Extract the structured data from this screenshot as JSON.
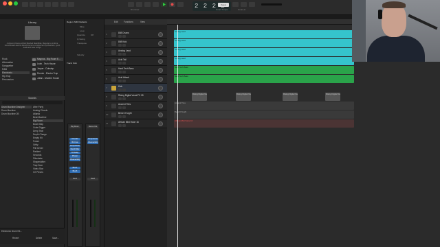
{
  "toolbar": {
    "lcd": "2 2 2 2",
    "labels": [
      "Drummer",
      "Smart Tempo",
      "Tuner",
      "Count-in"
    ],
    "tempo_badge": "Keep"
  },
  "library": {
    "title": "Library",
    "description": "A dynamic Dance-Hybrid Mashed Beat/Mike, Maguire & combine Grooveboard  electric-sound drums to complement synthesizers, synth leads and bass strings.",
    "categories": [
      "Rock",
      "Alternative",
      "Songwriter",
      "R&B",
      "Electronic",
      "Hip Hop",
      "Percussion"
    ],
    "drummers": [
      {
        "name": "Magnus - Big Room E..."
      },
      {
        "name": "Leah - Tech House"
      },
      {
        "name": "Jasper - Dubstep"
      },
      {
        "name": "Ronnie - Electro Trap"
      },
      {
        "name": "Julian - Modern House"
      }
    ],
    "sounds_title": "Sounds",
    "sound_cats": [
      "Drum Machine Designer",
      "Drum Machine",
      "Drum Machine 2B"
    ],
    "sound_items": [
      "After Party",
      "Analog Chords",
      "Atlanta",
      "Beat Machine",
      "Big Room",
      "Boom Bap",
      "Crate Digger",
      "Deep Tech",
      "Depth Charge",
      "Empty Kit",
      "Future",
      "Gritty",
      "Pile Driver",
      "Radiant",
      "Seconds",
      "Silverlake",
      "Shapeshifter",
      "Trap Door",
      "Video Star",
      "XX Pieces"
    ],
    "footer_label": "Electronic Drum Kit...",
    "revert": "Revert",
    "delete": "Delete",
    "save": "Save..."
  },
  "inspector": {
    "region_title": "Region: MIDI Defaults",
    "fields": [
      "Mute",
      "Loop",
      "Quantize",
      "Q-Swing",
      "Transpose",
      "Velocity"
    ],
    "field_values": [
      "",
      "",
      "Off",
      "",
      "",
      ""
    ],
    "track_label": "Track: Kick",
    "channel_name": "Big Room",
    "ch2": "Stereo Out",
    "plugins": [
      "Drumkit",
      "Bit Crus",
      "Compressor",
      "Rand Filter",
      "Dr Delay",
      "Phaser",
      "Channel EQ"
    ],
    "bus_labels": [
      "Bus 4",
      "Bus 6"
    ],
    "bottom_labels": [
      "M",
      "S",
      "Bnce"
    ],
    "read": "Read"
  },
  "tracks": [
    {
      "num": "1",
      "name": "808 Drums"
    },
    {
      "num": "2",
      "name": "808 Kick"
    },
    {
      "num": "3",
      "name": "Analog Lead"
    },
    {
      "num": "4",
      "name": "Acid Tail"
    },
    {
      "num": "5",
      "name": "Hard Tech Bass"
    },
    {
      "num": "6",
      "name": "Acid Attack"
    },
    {
      "num": "7",
      "name": "Kick"
    },
    {
      "num": "8",
      "name": "Rising Digital Vocal FX 05"
    },
    {
      "num": "9",
      "name": "Ancient Tiles"
    },
    {
      "num": "10",
      "name": "Bend Of Light"
    },
    {
      "num": "11",
      "name": "African Mist Voice 16"
    }
  ],
  "arrange_header": [
    "Edit",
    "Functions",
    "View"
  ],
  "snap": "Snap",
  "drag": "Drag",
  "regions": {
    "cyan": "Analog Lead",
    "green": "Hard Tech Bass",
    "kick": "Kick",
    "vocal": "Rising Digital Vocal FX 05",
    "tiles": "Ancient Tiles",
    "bend": "Bend Of Light",
    "african": "African Mist Voice 16"
  },
  "colors": {
    "cyan": "#35c4cc",
    "green": "#2aa34a",
    "play": "#2ecc40",
    "record": "#e34b4b"
  }
}
